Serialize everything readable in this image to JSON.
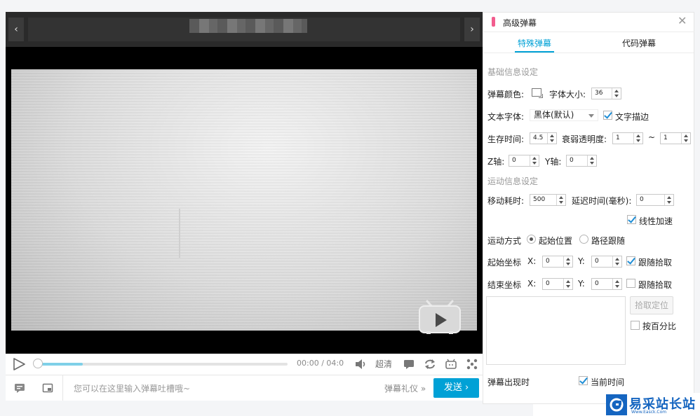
{
  "player": {
    "prev_icon": "chevron-left-icon",
    "next_icon": "chevron-right-icon",
    "logo_icon": "tv-play-icon",
    "time_current": "00:00",
    "time_separator": "/",
    "time_total": "04:0",
    "progress": 0.19,
    "quality": "超清",
    "input_placeholder": "您可以在这里输入弹幕吐槽哦~",
    "gift": "弹幕礼仪",
    "gift_arrow": "»",
    "send": "发送",
    "send_arrow": "›"
  },
  "panel": {
    "title": "高级弹幕",
    "close": "✕",
    "tabs": [
      "特殊弹幕",
      "代码弹幕"
    ],
    "basic_section": "基础信息设定",
    "color_label": "弹幕颜色:",
    "size_label": "字体大小:",
    "size_value": "36",
    "font_label": "文本字体:",
    "font_value": "黑体(默认)",
    "stroke_label": "文字描边",
    "life_label": "生存时间:",
    "life_value": "4.5",
    "fade_label": "衰弱透明度:",
    "fade_from": "1",
    "fade_sep": "~",
    "fade_to": "1",
    "z_label": "Z轴:",
    "z_value": "0",
    "y_label": "Y轴:",
    "y_value": "0",
    "motion_section": "运动信息设定",
    "move_label": "移动耗时:",
    "move_value": "500",
    "delay_label": "延迟时间(毫秒):",
    "delay_value": "0",
    "linear_label": "线性加速",
    "mode_label": "运动方式",
    "mode_start": "起始位置",
    "mode_path": "路径跟随",
    "start_label": "起始坐标",
    "end_label": "结束坐标",
    "x_axis": "X:",
    "y_axis": "Y:",
    "start_x": "0",
    "start_y": "0",
    "end_x": "0",
    "end_y": "0",
    "follow_label": "跟随拾取",
    "pick_button": "拾取定位",
    "percent_label": "按百分比",
    "appear_label": "弹幕出现时",
    "current_time_label": "当前时间"
  },
  "watermark": {
    "text": "易采站长站",
    "sub": "Www.Easck.Com"
  },
  "colors": {
    "accent": "#00a1d6",
    "mark": "#f25d8e",
    "progress": "#7fd0e8"
  }
}
